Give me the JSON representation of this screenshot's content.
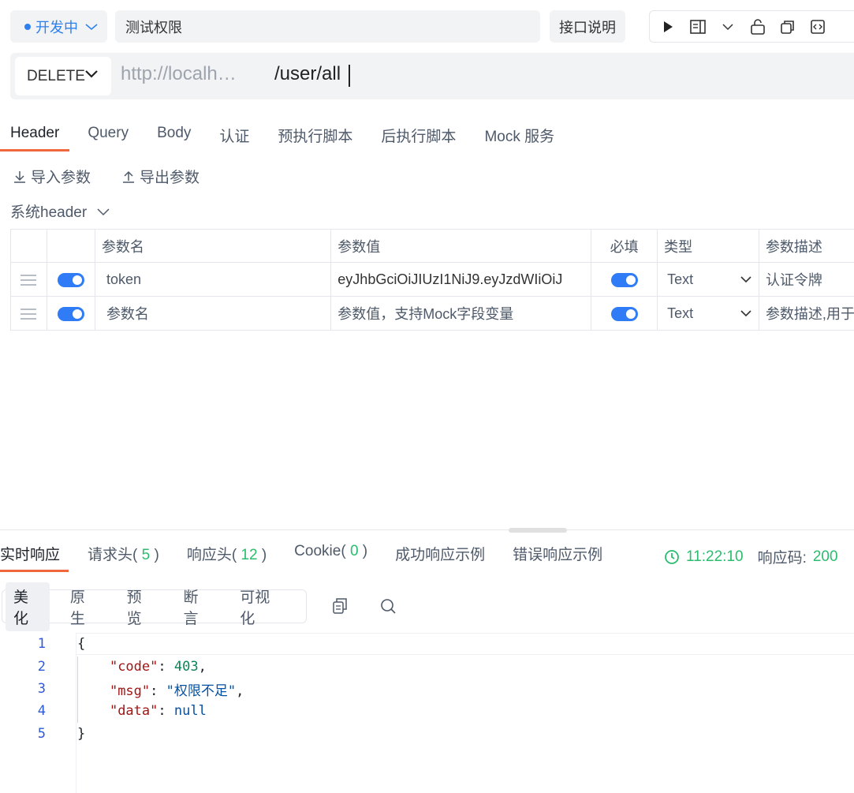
{
  "top": {
    "status": "开发中",
    "name": "测试权限",
    "doc_button": "接口说明"
  },
  "url": {
    "method": "DELETE",
    "base": "http://localh…",
    "path": "/user/all"
  },
  "request_tabs": [
    "Header",
    "Query",
    "Body",
    "认证",
    "预执行脚本",
    "后执行脚本",
    "Mock 服务"
  ],
  "actions": {
    "import": "导入参数",
    "export": "导出参数",
    "system_header": "系统header"
  },
  "table": {
    "headers": [
      "参数名",
      "参数值",
      "必填",
      "类型",
      "参数描述"
    ],
    "rows": [
      {
        "name": "token",
        "value": "eyJhbGciOiJIUzI1NiJ9.eyJzdWIiOiJ",
        "type": "Text",
        "desc": "认证令牌"
      }
    ],
    "placeholder": {
      "name": "参数名",
      "value": "参数值，支持Mock字段变量",
      "type": "Text",
      "desc": "参数描述,用于"
    }
  },
  "response_tabs": {
    "realtime": "实时响应",
    "req_headers": "请求头(",
    "req_headers_count": "5",
    "resp_headers": "响应头(",
    "resp_headers_count": "12",
    "cookie": "Cookie(",
    "cookie_count": "0",
    "close_paren": ")",
    "success_example": "成功响应示例",
    "error_example": "错误响应示例"
  },
  "response_meta": {
    "time": "11:22:10",
    "code_label": "响应码:",
    "code": "200"
  },
  "view_tabs": [
    "美化",
    "原生",
    "预览",
    "断言",
    "可视化"
  ],
  "code_lines": [
    "1",
    "2",
    "3",
    "4",
    "5"
  ],
  "json": {
    "open": "{",
    "close": "}",
    "code_key": "\"code\"",
    "code_val": "403",
    "msg_key": "\"msg\"",
    "msg_val": "\"权限不足\"",
    "data_key": "\"data\"",
    "data_val": "null"
  },
  "colors": {
    "accent": "#f0663d",
    "primary": "#2f7cf6",
    "success": "#2bbd6e"
  }
}
